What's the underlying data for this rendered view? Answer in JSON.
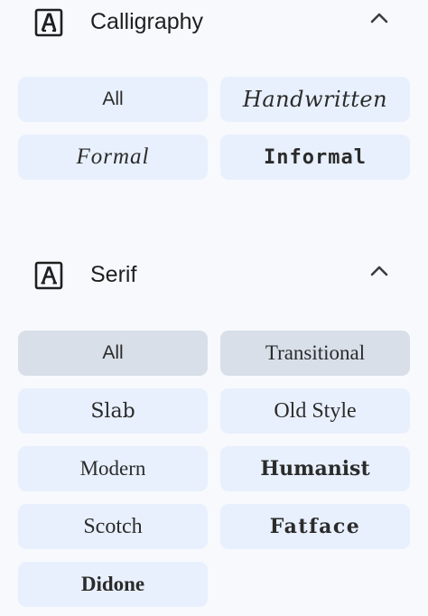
{
  "sections": [
    {
      "title": "Calligraphy",
      "icon": "calligraphy-font-icon",
      "expanded": true,
      "chips": [
        {
          "label": "All",
          "selected": false
        },
        {
          "label": "Handwritten",
          "selected": false
        },
        {
          "label": "Formal",
          "selected": false
        },
        {
          "label": "Informal",
          "selected": false
        }
      ]
    },
    {
      "title": "Serif",
      "icon": "serif-font-icon",
      "expanded": true,
      "chips": [
        {
          "label": "All",
          "selected": true
        },
        {
          "label": "Transitional",
          "selected": true
        },
        {
          "label": "Slab",
          "selected": false
        },
        {
          "label": "Old Style",
          "selected": false
        },
        {
          "label": "Modern",
          "selected": false
        },
        {
          "label": "Humanist",
          "selected": false
        },
        {
          "label": "Scotch",
          "selected": false
        },
        {
          "label": "Fatface",
          "selected": false
        },
        {
          "label": "Didone",
          "selected": false
        }
      ]
    }
  ],
  "colors": {
    "background": "#f7f9fd",
    "chip": "#e8f0fd",
    "chip_selected": "#d8dfe9",
    "text": "#1f1f1f"
  }
}
